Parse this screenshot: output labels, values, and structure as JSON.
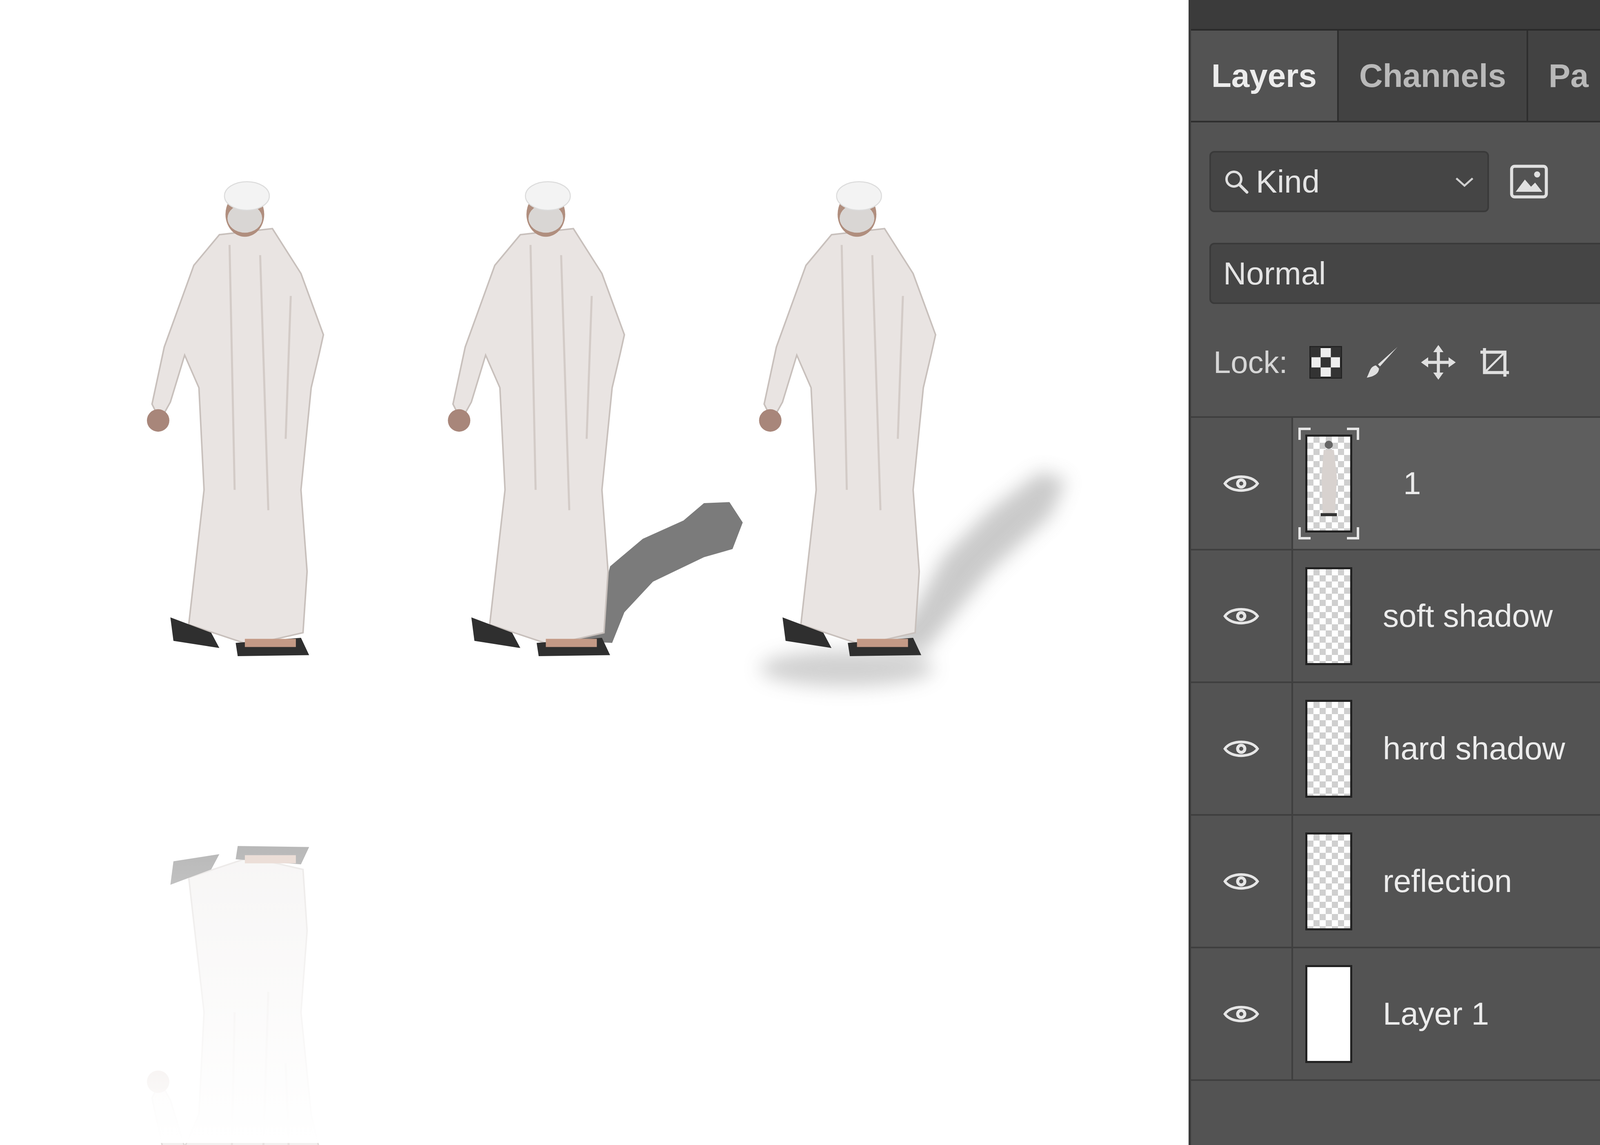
{
  "canvas": {
    "figures": [
      {
        "kind": "reflection"
      },
      {
        "kind": "hard-shadow"
      },
      {
        "kind": "soft-shadow"
      }
    ]
  },
  "panel": {
    "tabs": [
      {
        "label": "Layers",
        "selected": true
      },
      {
        "label": "Channels",
        "selected": false
      },
      {
        "label": "Pa",
        "selected": false
      }
    ],
    "filter": {
      "label": "Kind"
    },
    "blend_mode": "Normal",
    "lock": {
      "label": "Lock:"
    },
    "layers": [
      {
        "name": "1",
        "visible": true,
        "selected": true,
        "kind": "smart"
      },
      {
        "name": "soft shadow",
        "visible": true,
        "selected": false,
        "kind": "transparent"
      },
      {
        "name": "hard shadow",
        "visible": true,
        "selected": false,
        "kind": "transparent"
      },
      {
        "name": "reflection",
        "visible": true,
        "selected": false,
        "kind": "transparent"
      },
      {
        "name": "Layer 1",
        "visible": true,
        "selected": false,
        "kind": "fill"
      }
    ]
  }
}
